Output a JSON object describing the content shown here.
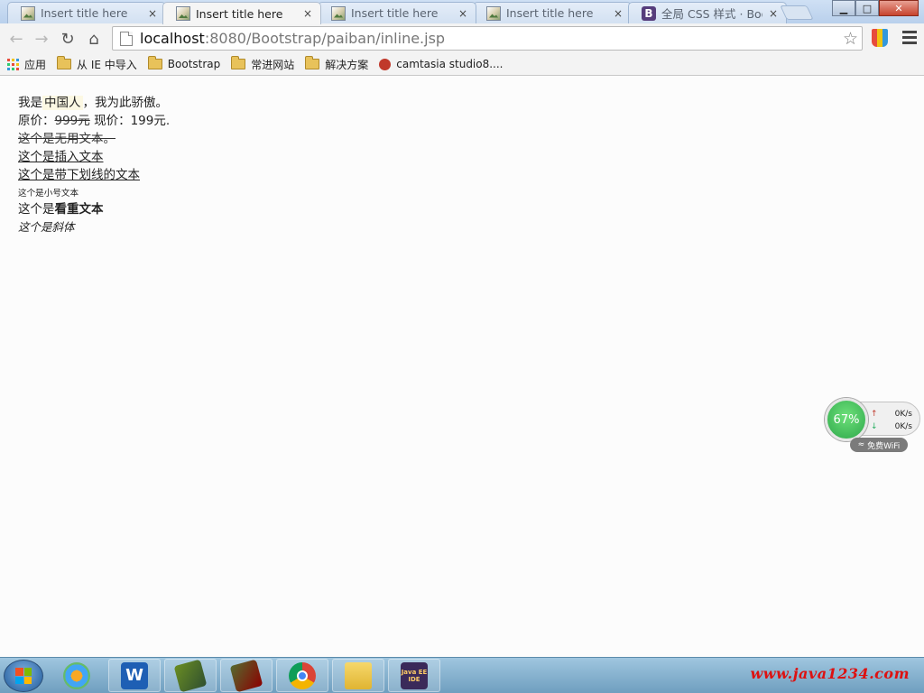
{
  "browser": {
    "tabs": [
      {
        "label": "Insert title here",
        "close": "×",
        "active": false
      },
      {
        "label": "Insert title here",
        "close": "×",
        "active": true
      },
      {
        "label": "Insert title here",
        "close": "×",
        "active": false
      },
      {
        "label": "Insert title here",
        "close": "×",
        "active": false
      },
      {
        "label": "全局 CSS 样式 · Boot",
        "close": "×",
        "active": false
      }
    ],
    "bootstrap_favicon": "B",
    "window_buttons": {
      "minimize": "▁",
      "maximize": "□",
      "close": "✕"
    },
    "url": {
      "host": "localhost",
      "path": ":8080/Bootstrap/paiban/inline.jsp"
    },
    "bookmarks": [
      {
        "label": "应用",
        "icon": "apps-icon"
      },
      {
        "label": "从 IE 中导入",
        "icon": "folder-icon"
      },
      {
        "label": "Bootstrap",
        "icon": "folder-icon"
      },
      {
        "label": "常进网站",
        "icon": "folder-icon"
      },
      {
        "label": "解决方案",
        "icon": "folder-icon"
      },
      {
        "label": "camtasia studio8....",
        "icon": "camtasia-icon"
      }
    ]
  },
  "content": {
    "line1": {
      "before": "我是",
      "mark": "中国人",
      "after": "，我为此骄傲。"
    },
    "line2": {
      "prefix": "原价：",
      "old_price": "999元",
      "middle": " 现价：",
      "new_price": "199元."
    },
    "line3": "这个是无用文本。",
    "line4": "这个是插入文本",
    "line5": "这个是带下划线的文本",
    "line6": "这个是小号文本",
    "line7": {
      "before": "这个是",
      "strong": "看重文本"
    },
    "line8": "这个是斜体"
  },
  "net_widget": {
    "percent": "67%",
    "upload": "0K/s",
    "download": "0K/s",
    "up_arrow": "↑",
    "down_arrow": "↓",
    "wifi_label": "免费WiFi"
  },
  "taskbar": {
    "items": [
      "wps-writer",
      "app-green",
      "app-red",
      "chrome",
      "file-explorer",
      "javaee-ide"
    ],
    "wps_letter": "W",
    "javaee_label": "Java EE IDE",
    "watermark": "www.java1234.com"
  },
  "colors": {
    "mark_bg": "#fcf8e3",
    "chrome_blue": "#b9d0ec",
    "wifi_green": "#2ea84a",
    "watermark_red": "#dd1111"
  }
}
